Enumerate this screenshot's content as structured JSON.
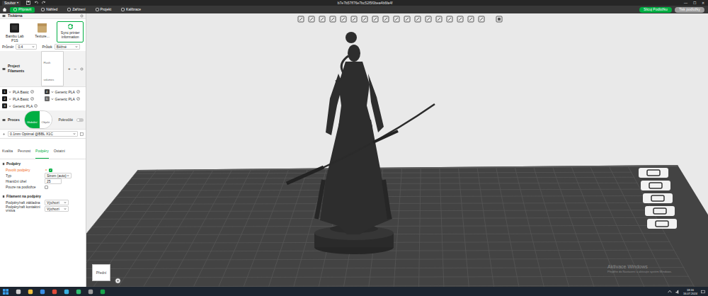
{
  "window": {
    "menu": "Soubor",
    "menu_arrow": "▾",
    "title": "b7e7b57ff76e7bc52f5f0bea4b6fa4f",
    "controls": [
      "—",
      "☐",
      "✕"
    ]
  },
  "nav": {
    "tabs": [
      {
        "label": "Připravit",
        "selected": true
      },
      {
        "label": "Náhled",
        "selected": false
      },
      {
        "label": "Zařízení",
        "selected": false
      },
      {
        "label": "Projekt",
        "selected": false
      },
      {
        "label": "Kalibrace",
        "selected": false
      }
    ],
    "slice_button": "Slicuj Podložku",
    "print_button": {
      "label": "Tisk podložky",
      "disabled": true
    }
  },
  "sidebar": {
    "printer": {
      "header": "Tiskárna",
      "name": "Bambu Lab P1S",
      "plate": "Texture...",
      "sync": "Sync printer information",
      "nozzle_label": "Průměr",
      "nozzle": "0.4",
      "flow_label": "Průtok",
      "flow": "Běžné"
    },
    "filaments": {
      "header": "Project Filaments",
      "flush": "Flush volumes",
      "add": "+",
      "remove": "−",
      "items": [
        {
          "index": "1",
          "name": "PLA Basic",
          "color": "#161616"
        },
        {
          "index": "2",
          "name": "PLA Basic",
          "color": "#161616"
        },
        {
          "index": "3",
          "name": "Generic PLA",
          "color": "#1e1e1e"
        },
        {
          "index": "4",
          "name": "Generic PLA",
          "color": "#3c3c3c"
        },
        {
          "index": "5",
          "name": "Generic PLA",
          "color": "#6b6b6b"
        }
      ]
    },
    "process": {
      "header": "Proces",
      "global": {
        "label": "Globální",
        "selected": true
      },
      "object": {
        "label": "Objekt",
        "selected": false
      },
      "advanced_label": "Pokročilé",
      "advanced": false,
      "preset": "0.1mm Optimal @BBL X1C",
      "tabs": [
        {
          "label": "Kvalita",
          "selected": false
        },
        {
          "label": "Pevnost",
          "selected": false
        },
        {
          "label": "Podpěry",
          "selected": true
        },
        {
          "label": "Ostatní",
          "selected": false
        }
      ],
      "sections": [
        {
          "title": "Podpěry",
          "rows": [
            {
              "kind": "checkbox",
              "label": "Povolit podpěry",
              "checked": true,
              "modified": true
            },
            {
              "kind": "select",
              "label": "Typ",
              "value": "Strom (auto)",
              "modified": false
            },
            {
              "kind": "number",
              "label": "Hraniční úhel",
              "value": "25",
              "modified": false
            },
            {
              "kind": "checkbox",
              "label": "Pouze na podložce",
              "checked": false,
              "modified": false
            }
          ]
        },
        {
          "title": "Filament na podpěry",
          "rows": [
            {
              "kind": "select",
              "label": "Podpěry/raft základna",
              "value": "Výchozí",
              "modified": false
            },
            {
              "kind": "select",
              "label": "Podpěry/raft kontaktní vrstva",
              "value": "Výchozí",
              "modified": false
            }
          ]
        }
      ]
    }
  },
  "viewport": {
    "view_cube": "Přední",
    "watermark": {
      "title": "Aktivace Windows",
      "subtitle": "Přejděte do Nastavení a aktivujte systém Windows."
    }
  },
  "taskbar": {
    "time": "18:16",
    "date": "16.07.2024"
  }
}
